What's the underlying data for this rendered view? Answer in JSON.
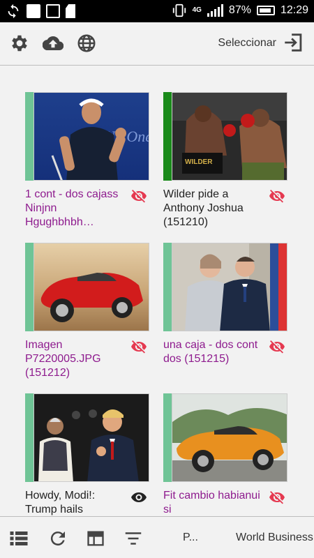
{
  "status_bar": {
    "network": "4G",
    "battery_percent": "87%",
    "time": "12:29"
  },
  "toolbar": {
    "icons": [
      "gear-icon",
      "cloud-upload-icon",
      "globe-icon"
    ],
    "select_label": "Seleccionar",
    "exit_icon": "exit-icon"
  },
  "items": [
    {
      "title": "1 cont - dos cajass Ninjnn Hgughbhbh…",
      "title_color": "#8e1b8e",
      "accent": "#6fc496",
      "eye_icon": "eye-off-icon",
      "eye_color": "#e53950"
    },
    {
      "title": "Wilder pide a Anthony Joshua (151210)",
      "title_color": "#222222",
      "accent": "#1a8a1a",
      "eye_icon": "eye-off-icon",
      "eye_color": "#e53950"
    },
    {
      "title": "Imagen P7220005.JPG (151212)",
      "title_color": "#8e1b8e",
      "accent": "#6fc496",
      "eye_icon": "eye-off-icon",
      "eye_color": "#e53950"
    },
    {
      "title": "una caja - dos cont dos (151215)",
      "title_color": "#8e1b8e",
      "accent": "#6fc496",
      "eye_icon": "eye-off-icon",
      "eye_color": "#e53950"
    },
    {
      "title": "Howdy, Modi!: Trump hails",
      "title_color": "#222222",
      "accent": "#6fc496",
      "eye_icon": "eye-icon",
      "eye_color": "#222222"
    },
    {
      "title": "Fit cambio habianui si",
      "title_color": "#8e1b8e",
      "accent": "#6fc496",
      "eye_icon": "eye-off-icon",
      "eye_color": "#e53950"
    }
  ],
  "bottom_bar": {
    "icons": [
      "list-icon",
      "refresh-icon",
      "layout-icon",
      "filter-icon"
    ],
    "tab_short": "P...",
    "tab_label": "World Business"
  }
}
